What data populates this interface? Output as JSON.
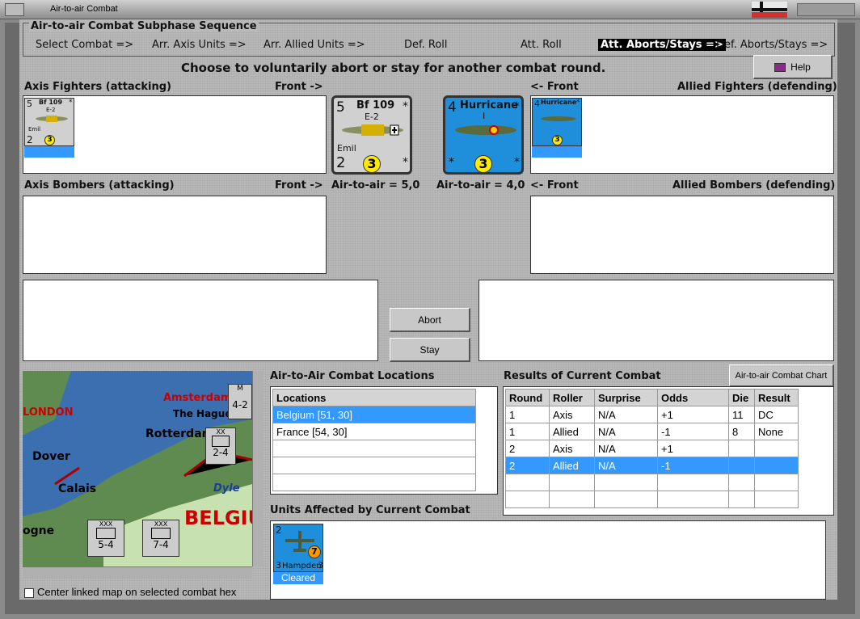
{
  "window": {
    "title": "Air-to-air Combat"
  },
  "sequence": {
    "header": "Air-to-air Combat Subphase Sequence",
    "steps": [
      "Select Combat =>",
      "Arr. Axis Units =>",
      "Arr. Allied Units =>",
      "Def. Roll",
      "Att. Roll",
      "Att. Aborts/Stays =>",
      "Def. Aborts/Stays =>"
    ],
    "active_index": 5
  },
  "instruction": "Choose to voluntarily abort or stay for another combat round.",
  "help_label": "Help",
  "axis_fighters": {
    "label": "Axis Fighters (attacking)",
    "front": "Front ->",
    "unit": {
      "name": "Bf 109",
      "model": "E-2",
      "nickname": "Emil",
      "left_top": "5",
      "left_bottom": "2",
      "strength": "3",
      "corner": "*"
    }
  },
  "allied_fighters": {
    "label": "Allied Fighters (defending)",
    "front": "<- Front",
    "unit": {
      "name": "Hurricane",
      "model": "I",
      "left_top": "4",
      "strength": "3",
      "corner": "*"
    }
  },
  "axis_bombers": {
    "label": "Axis Bombers (attacking)",
    "front": "Front ->"
  },
  "allied_bombers": {
    "label": "Allied Bombers (defending)",
    "front": "<- Front"
  },
  "air_to_air": {
    "axis": "Air-to-air = 5,0",
    "allied": "Air-to-air = 4,0"
  },
  "buttons": {
    "abort": "Abort",
    "stay": "Stay",
    "chart": "Air-to-air Combat Chart"
  },
  "locations": {
    "title": "Air-to-Air Combat Locations",
    "header": "Locations",
    "rows": [
      "Belgium [51, 30]",
      "France [54, 30]",
      "",
      "",
      ""
    ],
    "selected_index": 0
  },
  "results": {
    "title": "Results of Current Combat",
    "headers": [
      "Round",
      "Roller",
      "Surprise",
      "Odds",
      "Die",
      "Result"
    ],
    "rows": [
      [
        "1",
        "Axis",
        "N/A",
        "+1",
        "11",
        "DC"
      ],
      [
        "1",
        "Allied",
        "N/A",
        "-1",
        "8",
        "None"
      ],
      [
        "2",
        "Axis",
        "N/A",
        "+1",
        "",
        ""
      ],
      [
        "2",
        "Allied",
        "N/A",
        "-1",
        "",
        ""
      ],
      [
        "",
        "",
        "",
        "",
        "",
        ""
      ],
      [
        "",
        "",
        "",
        "",
        "",
        ""
      ]
    ],
    "selected_index": 3
  },
  "affected": {
    "title": "Units Affected by Current Combat",
    "unit": {
      "name": "Hampden",
      "top_left": "2",
      "bottom_left": "3",
      "bottom_right": "3",
      "strength": "7",
      "status": "Cleared"
    }
  },
  "map": {
    "labels": [
      "Amsterdam",
      "The Hague",
      "Rotterdam",
      "LONDON",
      "Dover",
      "Calais",
      "Dyle",
      "BELGIUM",
      "ogne"
    ],
    "units": [
      {
        "corps": "XX",
        "value": "2-4"
      },
      {
        "corps": "XXX",
        "value": "5-4"
      },
      {
        "corps": "XXX",
        "value": "7-4"
      },
      {
        "corps": "M",
        "value": "4-2"
      }
    ]
  },
  "center_map_checkbox": {
    "label": "Center linked map on selected combat hex",
    "checked": false
  },
  "colors": {
    "selection": "#3399ff",
    "active_step_bg": "#000000",
    "hurricane_blue": "#1f8fdc",
    "germany_gray": "#d0d0d0"
  }
}
